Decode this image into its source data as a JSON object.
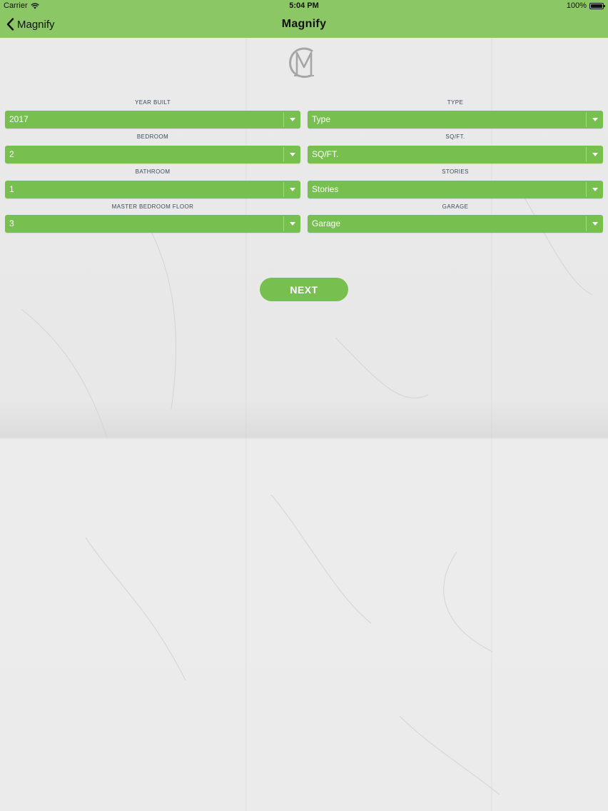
{
  "status_bar": {
    "carrier": "Carrier",
    "time": "5:04 PM",
    "battery": "100%"
  },
  "nav": {
    "back_label": "Magnify",
    "title": "Magnify"
  },
  "form": {
    "left": [
      {
        "label": "YEAR BUILT",
        "value": "2017"
      },
      {
        "label": "BEDROOM",
        "value": "2"
      },
      {
        "label": "BATHROOM",
        "value": "1"
      },
      {
        "label": "MASTER BEDROOM FLOOR",
        "value": "3"
      }
    ],
    "right": [
      {
        "label": "TYPE",
        "value": "Type"
      },
      {
        "label": "SQ/FT.",
        "value": "SQ/FT."
      },
      {
        "label": "STORIES",
        "value": "Stories"
      },
      {
        "label": "GARAGE",
        "value": "Garage"
      }
    ]
  },
  "next_label": "NEXT",
  "colors": {
    "nav_bar": "#8cc765",
    "accent": "#77c04f",
    "label_text": "#3b4a5c"
  }
}
